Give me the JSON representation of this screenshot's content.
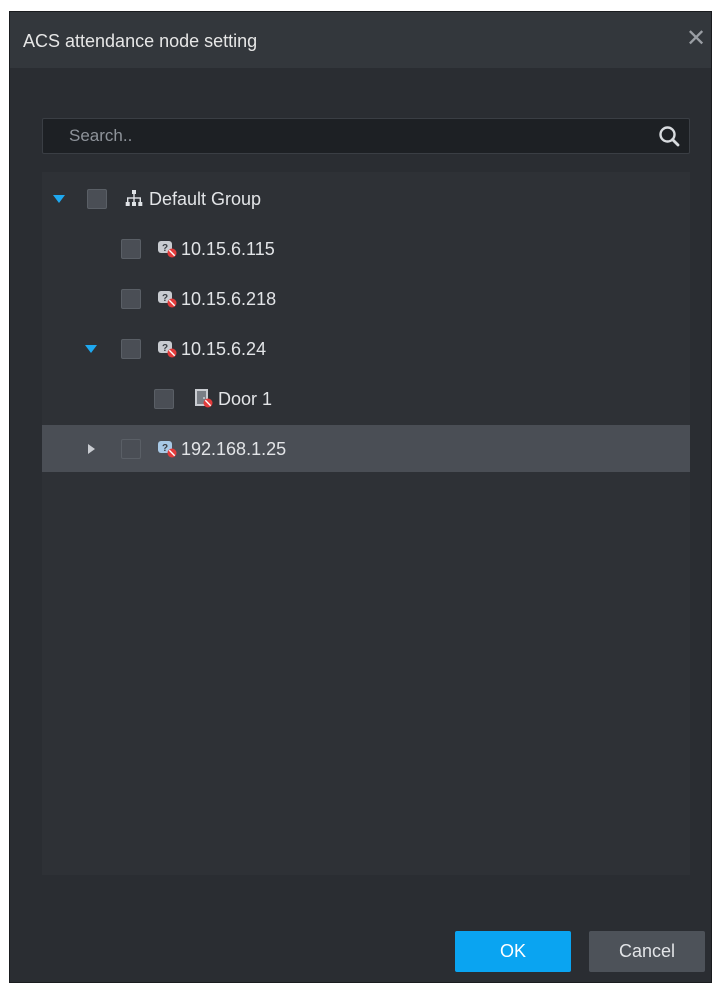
{
  "dialog": {
    "title": "ACS attendance node setting",
    "close_symbol": "✕"
  },
  "search": {
    "placeholder": "Search..",
    "value": ""
  },
  "tree": {
    "nodes": [
      {
        "label": "Default Group",
        "icon": "group-icon",
        "expanded": true,
        "checked": false,
        "level": 0
      },
      {
        "label": "10.15.6.115",
        "icon": "device-offline-icon",
        "checked": false,
        "level": 1
      },
      {
        "label": "10.15.6.218",
        "icon": "device-offline-icon",
        "checked": false,
        "level": 1
      },
      {
        "label": "10.15.6.24",
        "icon": "device-offline-icon",
        "expanded": true,
        "checked": false,
        "level": 1
      },
      {
        "label": "Door 1",
        "icon": "door-offline-icon",
        "checked": false,
        "level": 2
      },
      {
        "label": "192.168.1.25",
        "icon": "device-offline-icon",
        "expanded": false,
        "checked": false,
        "level": 1,
        "selected": true
      }
    ]
  },
  "buttons": {
    "ok": "OK",
    "cancel": "Cancel"
  },
  "colors": {
    "dialog_bg": "#2a2d32",
    "accent": "#0aa4f1",
    "expand_arrow": "#1ea8f0",
    "selected_row": "#4a4e55"
  }
}
